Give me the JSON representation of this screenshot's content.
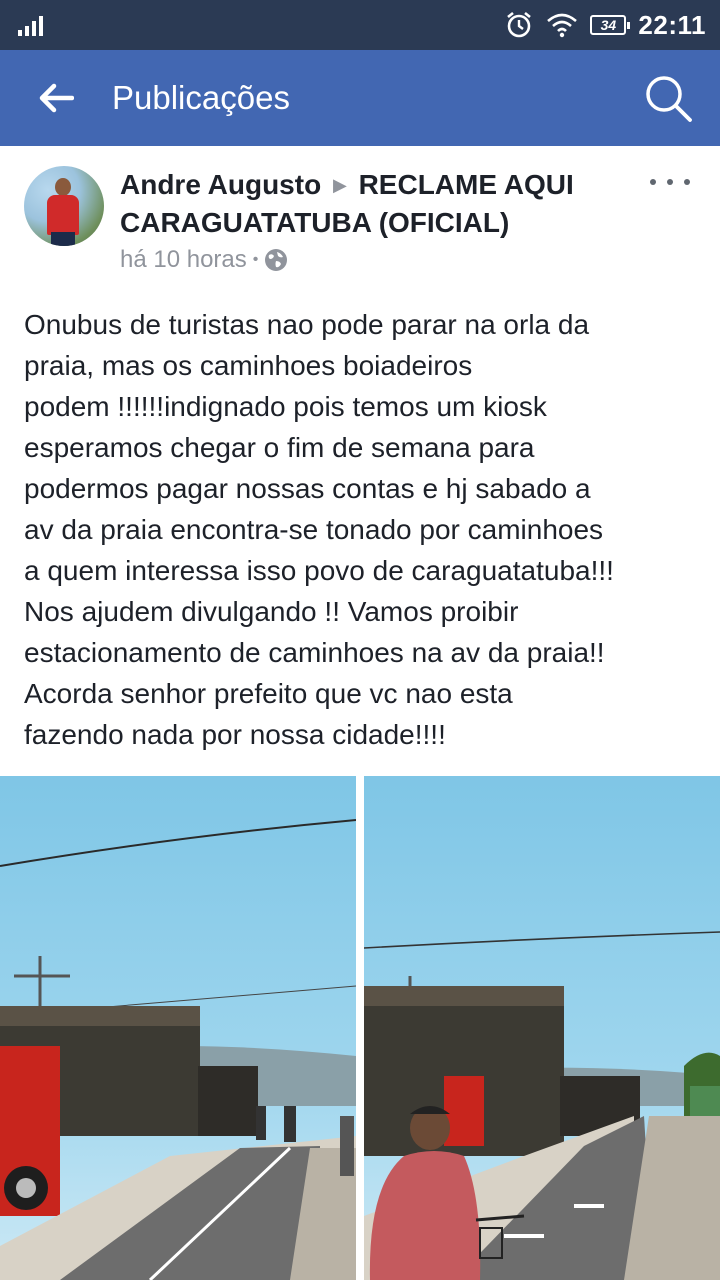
{
  "status_bar": {
    "battery": "34",
    "time": "22:11"
  },
  "app_bar": {
    "title": "Publicações"
  },
  "post": {
    "author": "Andre Augusto",
    "group": "RECLAME AQUI CARAGUATATUBA (OFICIAL)",
    "time": "há 10 horas",
    "separator": "•",
    "audience_icon": "globe-icon",
    "text": "Onubus de turistas nao pode parar na orla da\npraia, mas  os caminhoes boiadeiros\npodem !!!!!!indignado pois temos um  kiosk\nesperamos chegar o fim de semana para\npodermos pagar nossas contas  e hj sabado a\nav da praia encontra-se tonado por caminhoes\na quem interessa isso povo de caraguatatuba!!!\nNos ajudem divulgando !! Vamos proibir\nestacionamento de caminhoes na av da praia!!\nAcorda senhor prefeito que vc nao esta\nfazendo nada por nossa cidade!!!!"
  },
  "colors": {
    "status_bar": "#2b3a54",
    "app_bar": "#4267b2",
    "text": "#1d2129",
    "meta": "#90949c"
  }
}
